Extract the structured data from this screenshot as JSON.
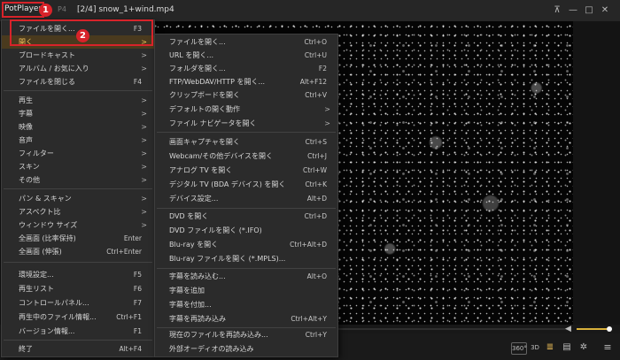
{
  "titlebar": {
    "app_name": "PotPlayer",
    "format_fragment": "P4",
    "file_title": "[2/4]  snow_1+wind.mp4",
    "pin_icon": "pin-icon",
    "minimize_icon": "minimize-icon",
    "maximize_icon": "maximize-icon",
    "close_icon": "close-icon"
  },
  "callouts": {
    "first": "1",
    "second": "2"
  },
  "accent_color": "#f2c259",
  "callout_color": "#d8232a",
  "main_menu": {
    "items": [
      {
        "label": "ファイルを開く...",
        "shortcut": "F3",
        "arrow": ""
      },
      {
        "label": "開く",
        "shortcut": "",
        "arrow": ">"
      },
      {
        "label": "ブロードキャスト",
        "shortcut": "",
        "arrow": ">"
      },
      {
        "label": "アルバム / お気に入り",
        "shortcut": "",
        "arrow": ">"
      },
      {
        "label": "ファイルを閉じる",
        "shortcut": "F4",
        "arrow": ""
      },
      {
        "label": "再生",
        "shortcut": "",
        "arrow": ">"
      },
      {
        "label": "字幕",
        "shortcut": "",
        "arrow": ">"
      },
      {
        "label": "映像",
        "shortcut": "",
        "arrow": ">"
      },
      {
        "label": "音声",
        "shortcut": "",
        "arrow": ">"
      },
      {
        "label": "フィルター",
        "shortcut": "",
        "arrow": ">"
      },
      {
        "label": "スキン",
        "shortcut": "",
        "arrow": ">"
      },
      {
        "label": "その他",
        "shortcut": "",
        "arrow": ">"
      },
      {
        "label": "パン & スキャン",
        "shortcut": "",
        "arrow": ">"
      },
      {
        "label": "アスペクト比",
        "shortcut": "",
        "arrow": ">"
      },
      {
        "label": "ウィンドウ サイズ",
        "shortcut": "",
        "arrow": ">"
      },
      {
        "label": "全画面 (比率保持)",
        "shortcut": "Enter",
        "arrow": ""
      },
      {
        "label": "全画面 (伸張)",
        "shortcut": "Ctrl+Enter",
        "arrow": ""
      },
      {
        "label": "環境設定...",
        "shortcut": "F5",
        "arrow": ""
      },
      {
        "label": "再生リスト",
        "shortcut": "F6",
        "arrow": ""
      },
      {
        "label": "コントロールパネル...",
        "shortcut": "F7",
        "arrow": ""
      },
      {
        "label": "再生中のファイル情報...",
        "shortcut": "Ctrl+F1",
        "arrow": ""
      },
      {
        "label": "バージョン情報...",
        "shortcut": "F1",
        "arrow": ""
      },
      {
        "label": "終了",
        "shortcut": "Alt+F4",
        "arrow": ""
      }
    ]
  },
  "open_submenu": {
    "items": [
      {
        "label": "ファイルを開く...",
        "shortcut": "Ctrl+O",
        "arrow": ""
      },
      {
        "label": "URL を開く...",
        "shortcut": "Ctrl+U",
        "arrow": ""
      },
      {
        "label": "フォルダを開く...",
        "shortcut": "F2",
        "arrow": ""
      },
      {
        "label": "FTP/WebDAV/HTTP を開く...",
        "shortcut": "Alt+F12",
        "arrow": ""
      },
      {
        "label": "クリップボードを開く",
        "shortcut": "Ctrl+V",
        "arrow": ""
      },
      {
        "label": "デフォルトの開く動作",
        "shortcut": "",
        "arrow": ">"
      },
      {
        "label": "ファイル ナビゲータを開く",
        "shortcut": "",
        "arrow": ">"
      },
      {
        "label": "画面キャプチャを開く",
        "shortcut": "Ctrl+S",
        "arrow": ""
      },
      {
        "label": "Webcam/その他デバイスを開く",
        "shortcut": "Ctrl+J",
        "arrow": ""
      },
      {
        "label": "アナログ TV を開く",
        "shortcut": "Ctrl+W",
        "arrow": ""
      },
      {
        "label": "デジタル TV (BDA デバイス) を開く",
        "shortcut": "Ctrl+K",
        "arrow": ""
      },
      {
        "label": "デバイス設定...",
        "shortcut": "Alt+D",
        "arrow": ""
      },
      {
        "label": "DVD を開く",
        "shortcut": "Ctrl+D",
        "arrow": ""
      },
      {
        "label": "DVD ファイルを開く (*.IFO)",
        "shortcut": "",
        "arrow": ""
      },
      {
        "label": "Blu-ray を開く",
        "shortcut": "Ctrl+Alt+D",
        "arrow": ""
      },
      {
        "label": "Blu-ray ファイルを開く (*.MPLS)...",
        "shortcut": "",
        "arrow": ""
      },
      {
        "label": "字幕を読み込む...",
        "shortcut": "Alt+O",
        "arrow": ""
      },
      {
        "label": "字幕を追加",
        "shortcut": "",
        "arrow": ""
      },
      {
        "label": "字幕を付加...",
        "shortcut": "",
        "arrow": ""
      },
      {
        "label": "字幕を再読み込み",
        "shortcut": "Ctrl+Alt+Y",
        "arrow": ""
      },
      {
        "label": "現在のファイルを再読み込み...",
        "shortcut": "Ctrl+Y",
        "arrow": ""
      },
      {
        "label": "外部オーディオの読み込み",
        "shortcut": "",
        "arrow": ""
      }
    ]
  },
  "controls": {
    "vr_label": "360°",
    "three_d_label": "3D",
    "subtitle_icon": "subtitle-icon",
    "playlist_icon": "playlist-icon",
    "settings_icon": "gear-icon",
    "menu_icon": "hamburger-menu-icon",
    "volume_level": 0.95
  }
}
